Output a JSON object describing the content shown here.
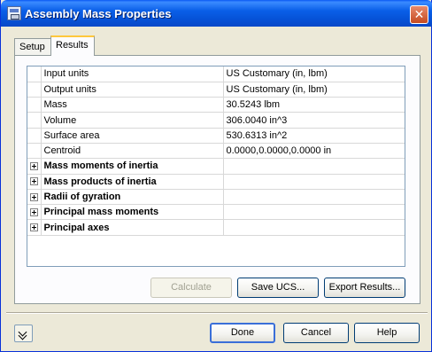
{
  "window": {
    "title": "Assembly Mass Properties",
    "close_glyph": "✕"
  },
  "tabs": [
    {
      "label": "Setup",
      "active": false
    },
    {
      "label": "Results",
      "active": true
    }
  ],
  "properties": [
    {
      "name": "Input units",
      "value": "US Customary (in, lbm)",
      "expandable": false
    },
    {
      "name": "Output units",
      "value": "US Customary (in, lbm)",
      "expandable": false
    },
    {
      "name": "Mass",
      "value": "30.5243 lbm",
      "expandable": false
    },
    {
      "name": "Volume",
      "value": "306.0040 in^3",
      "expandable": false
    },
    {
      "name": "Surface area",
      "value": "530.6313 in^2",
      "expandable": false
    },
    {
      "name": "Centroid",
      "value": "0.0000,0.0000,0.0000 in",
      "expandable": false
    },
    {
      "name": "Mass moments of inertia",
      "value": "",
      "expandable": true
    },
    {
      "name": "Mass products of inertia",
      "value": "",
      "expandable": true
    },
    {
      "name": "Radii of gyration",
      "value": "",
      "expandable": true
    },
    {
      "name": "Principal mass moments",
      "value": "",
      "expandable": true
    },
    {
      "name": "Principal axes",
      "value": "",
      "expandable": true
    }
  ],
  "buttons": {
    "calculate": "Calculate",
    "save_ucs": "Save UCS...",
    "export_results": "Export Results...",
    "done": "Done",
    "cancel": "Cancel",
    "help": "Help"
  }
}
